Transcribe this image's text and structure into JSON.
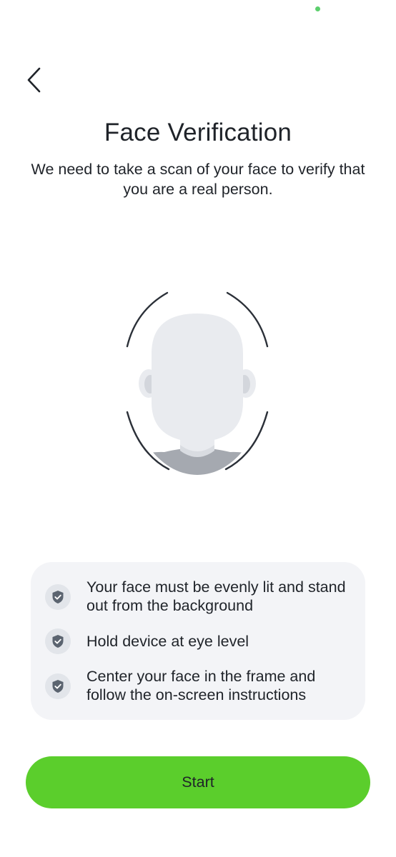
{
  "header": {
    "back_icon": "chevron-left-icon"
  },
  "main": {
    "title": "Face Verification",
    "subtitle": "We need to take a scan of your face to verify that you are a real person."
  },
  "tips": {
    "icon": "shield-check-icon",
    "items": [
      {
        "text": "Your face must be evenly lit and stand out from the background"
      },
      {
        "text": "Hold device at eye level"
      },
      {
        "text": "Center your face in the frame and follow the on-screen instructions"
      }
    ]
  },
  "actions": {
    "start_label": "Start"
  },
  "colors": {
    "accent": "#5bce2c",
    "status_dot": "#5ccf6d",
    "card_bg": "#f3f4f7",
    "icon_fill": "#5b6470",
    "text": "#1f2329"
  }
}
